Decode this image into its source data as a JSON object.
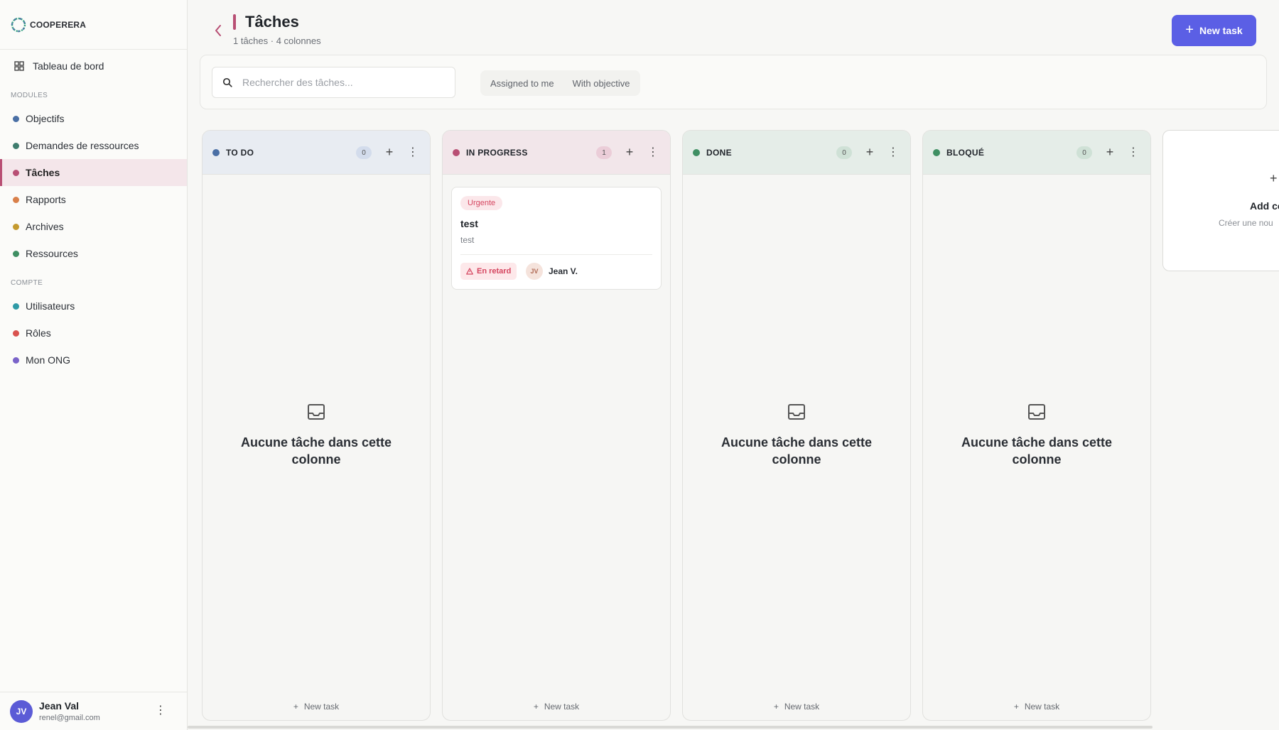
{
  "brand": {
    "name": "COOPERERA"
  },
  "sidebar": {
    "dashboard": {
      "label": "Tableau de bord"
    },
    "modules_title": "MODULES",
    "modules": [
      {
        "label": "Objectifs",
        "color": "#4a6fa5"
      },
      {
        "label": "Demandes de ressources",
        "color": "#3f7d6e"
      },
      {
        "label": "Tâches",
        "color": "#b84f74",
        "active": true
      },
      {
        "label": "Rapports",
        "color": "#d9804a"
      },
      {
        "label": "Archives",
        "color": "#c49a2f"
      },
      {
        "label": "Ressources",
        "color": "#3f8f63"
      }
    ],
    "account_title": "COMPTE",
    "account": [
      {
        "label": "Utilisateurs",
        "color": "#2f9aa6"
      },
      {
        "label": "Rôles",
        "color": "#d9534f"
      },
      {
        "label": "Mon ONG",
        "color": "#7a63c9"
      }
    ],
    "user": {
      "initials": "JV",
      "name": "Jean Val",
      "email": "renel@gmail.com"
    }
  },
  "header": {
    "title": "Tâches",
    "subtitle": "1 tâches · 4 colonnes",
    "new_task_label": "New task"
  },
  "filters": {
    "search_placeholder": "Rechercher des tâches...",
    "chips": [
      "Assigned to me",
      "With objective"
    ]
  },
  "columns": [
    {
      "title": "TO DO",
      "count": "0",
      "dot_color": "#4a6fa5",
      "head_bg": "#e8ecf2",
      "count_bg": "#d3dcec",
      "empty_text": "Aucune tâche dans cette colonne",
      "footer": "New task"
    },
    {
      "title": "IN PROGRESS",
      "count": "1",
      "dot_color": "#b84f74",
      "head_bg": "#f2e6ea",
      "count_bg": "#ebcdd8",
      "footer": "New task",
      "task": {
        "priority": "Urgente",
        "title": "test",
        "description": "test",
        "status": "En retard",
        "assignee_initials": "JV",
        "assignee": "Jean V."
      }
    },
    {
      "title": "DONE",
      "count": "0",
      "dot_color": "#3f8f63",
      "head_bg": "#e5ede8",
      "count_bg": "#cfe1d6",
      "empty_text": "Aucune tâche dans cette colonne",
      "footer": "New task"
    },
    {
      "title": "BLOQUÉ",
      "count": "0",
      "dot_color": "#3f8f63",
      "head_bg": "#e5ede8",
      "count_bg": "#cfe1d6",
      "empty_text": "Aucune tâche dans cette colonne",
      "footer": "New task"
    }
  ],
  "add_column": {
    "title": "Add co",
    "subtitle": "Créer une nou"
  },
  "colors": {
    "accent": "#5b5fe5",
    "active": "#b84f74"
  }
}
